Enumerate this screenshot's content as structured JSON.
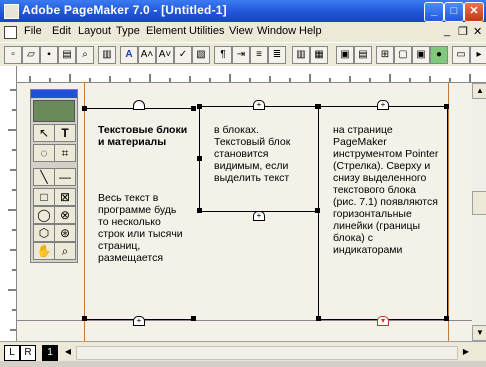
{
  "window": {
    "title": "Adobe PageMaker 7.0 - [Untitled-1]"
  },
  "menu": {
    "items": [
      "File",
      "Edit",
      "Layout",
      "Type",
      "Element",
      "Utilities",
      "View",
      "Window",
      "Help"
    ]
  },
  "colors": {
    "titlebar": "#2458d8",
    "guide": "#c47a3a",
    "toolbox_header": "#1f53d6"
  },
  "toolbar": {
    "icons": [
      "new-icon",
      "open-icon",
      "save-icon",
      "print-icon",
      "find-icon",
      "character-icon",
      "superscript-icon",
      "subscript-icon",
      "spelling-icon",
      "frame-icon",
      "paragraph-icon",
      "indent-icon",
      "bullets-icon",
      "align-left-icon",
      "align-center-icon",
      "align-right-icon",
      "grid-icon",
      "place-icon",
      "link-icon",
      "web-icon",
      "help-icon"
    ]
  },
  "blocks": {
    "left": {
      "heading": "Текстовые блоки и материалы",
      "body": "Весь текст в программе будь то несколько строк или тысячи страниц, размещается"
    },
    "middle": {
      "body": "в блоках. Текстовый блок становится видимым, если выделить текст"
    },
    "right": {
      "body": "на странице PageMaker инструментом Pointer (Стрелка). Сверху и снизу выделенного текстового блока (рис. 7.1) появляются горизонтальные линейки (границы блока) с индикаторами"
    }
  },
  "toolbox": {
    "tools": [
      "pointer-tool-icon",
      "text-tool-icon",
      "rotate-tool-icon",
      "crop-tool-icon",
      "line-tool-icon",
      "constrained-line-tool-icon",
      "rectangle-tool-icon",
      "rectangle-frame-tool-icon",
      "ellipse-tool-icon",
      "ellipse-frame-tool-icon",
      "polygon-tool-icon",
      "polygon-frame-tool-icon",
      "hand-tool-icon",
      "zoom-tool-icon"
    ]
  },
  "pages": {
    "left_master": "L",
    "right_master": "R",
    "current_page": "1"
  }
}
